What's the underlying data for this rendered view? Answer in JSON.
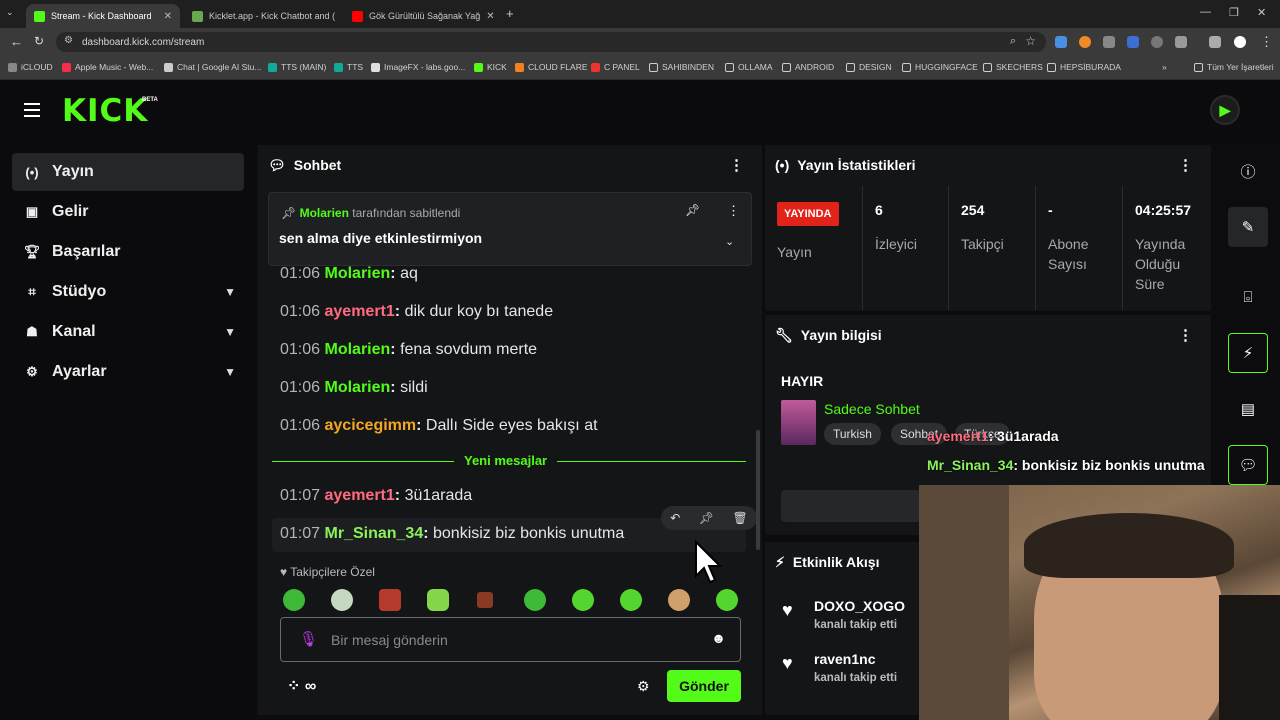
{
  "browser": {
    "tabs": [
      {
        "title": "Stream - Kick Dashboard",
        "color": "#53fc18"
      },
      {
        "title": "Kicklet.app - Kick Chatbot and (",
        "color": "#6aa84f"
      },
      {
        "title": "Gök Gürültülü Sağanak Yağ",
        "color": "#ff0000"
      }
    ],
    "url": "dashboard.kick.com/stream",
    "bookmarks": [
      "iCLOUD",
      "Apple Music - Web...",
      "Chat | Google AI Stu...",
      "TTS (MAIN)",
      "TTS",
      "ImageFX - labs.goo...",
      "KICK",
      "CLOUD FLARE",
      "C PANEL",
      "SAHIBINDEN",
      "OLLAMA",
      "ANDROID",
      "DESIGN",
      "HUGGINGFACE",
      "SKECHERS",
      "HEPSİBURADA"
    ],
    "all_bookmarks": "Tüm Yer İşaretleri"
  },
  "app": {
    "beta": "BETA"
  },
  "sidebar": {
    "items": [
      {
        "label": "Yayın"
      },
      {
        "label": "Gelir"
      },
      {
        "label": "Başarılar"
      },
      {
        "label": "Stüdyo"
      },
      {
        "label": "Kanal"
      },
      {
        "label": "Ayarlar"
      }
    ]
  },
  "chat": {
    "title": "Sohbet",
    "pinned": {
      "user": "Molarien",
      "suffix": "tarafından sabitlendi",
      "text": "sen alma diye etkinlestirmiyon"
    },
    "messages": [
      {
        "time": "01:06",
        "user": "Molarien",
        "color": "#53fc18",
        "text": "aq"
      },
      {
        "time": "01:06",
        "user": "ayemert1",
        "color": "#ff6b81",
        "text": "dik dur koy bı tanede"
      },
      {
        "time": "01:06",
        "user": "Molarien",
        "color": "#53fc18",
        "text": "fena sovdum merte"
      },
      {
        "time": "01:06",
        "user": "Molarien",
        "color": "#53fc18",
        "text": "sildi"
      },
      {
        "time": "01:06",
        "user": "aycicegimm",
        "color": "#f5a623",
        "text": "Dallı Side eyes bakışı at"
      },
      {
        "time": "01:07",
        "user": "ayemert1",
        "color": "#ff6b81",
        "text": "3ü1arada"
      },
      {
        "time": "01:07",
        "user": "Mr_Sinan_34",
        "color": "#8cf25a",
        "text": "bonkisiz biz bonkis unutma"
      }
    ],
    "new_messages": "Yeni mesajlar",
    "emote_section": "Takipçilere Özel",
    "input_placeholder": "Bir mesaj gönderin",
    "send": "Gönder"
  },
  "stats": {
    "title": "Yayın İstatistikleri",
    "live_badge": "YAYINDA",
    "items": [
      {
        "value": "",
        "label": "Yayın"
      },
      {
        "value": "6",
        "label": "İzleyici"
      },
      {
        "value": "254",
        "label": "Takipçi"
      },
      {
        "value": "-",
        "label": "Abone Sayısı"
      },
      {
        "value": "04:25:57",
        "label": "Yayında Olduğu Süre"
      }
    ]
  },
  "info": {
    "title": "Yayın bilgisi",
    "stream_title": "HAYIR",
    "category": "Sadece Sohbet",
    "tags": [
      "Turkish",
      "Sohbet",
      "Türkçe"
    ]
  },
  "activity": {
    "title": "Etkinlik Akışı",
    "events": [
      {
        "user": "DOXO_XOGO",
        "text": "kanalı takip etti"
      },
      {
        "user": "raven1nc",
        "text": "kanalı takip etti"
      }
    ]
  },
  "overlay": {
    "line1_user": "ayemert1",
    "line1_text": ": 3ü1arada",
    "line2_user": "Mr_Sinan_34",
    "line2_text": ": bonkisiz biz bonkis unutma"
  }
}
